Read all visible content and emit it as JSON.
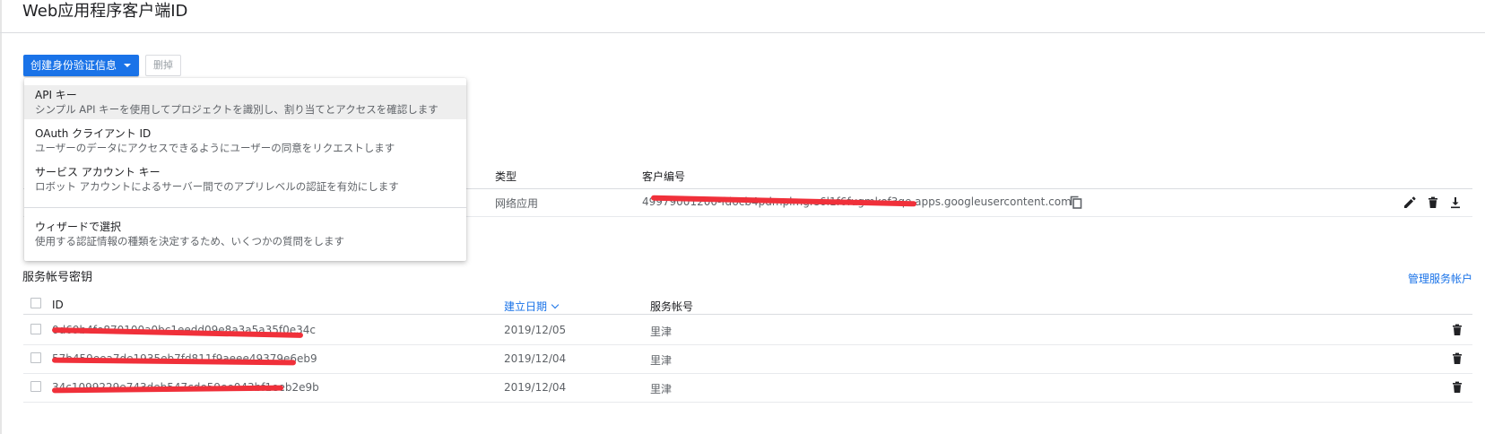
{
  "header": {
    "title": "Web应用程序客户端ID"
  },
  "toolbar": {
    "create_label": "创建身份验证信息",
    "delete_label": "删掉"
  },
  "create_menu": {
    "items": [
      {
        "title": "API キー",
        "desc": "シンプル API キーを使用してプロジェクトを識別し、割り当てとアクセスを確認します"
      },
      {
        "title": "OAuth クライアント ID",
        "desc": "ユーザーのデータにアクセスできるようにユーザーの同意をリクエストします"
      },
      {
        "title": "サービス アカウント キー",
        "desc": "ロボット アカウントによるサーバー間でのアプリレベルの認証を有効にします"
      },
      {
        "title": "ウィザードで選択",
        "desc": "使用する認証情報の種類を決定するため、いくつかの質問をします"
      }
    ]
  },
  "oauth_table": {
    "columns": {
      "type": "类型",
      "client_id": "客户编号"
    },
    "rows": [
      {
        "type": "网络应用",
        "client_id": "49979001200-fd6cb4pdmplmgrs6l1f6fugmkef3qe.apps.googleusercontent.com"
      }
    ]
  },
  "service_accounts": {
    "title": "服务帐号密钥",
    "manage_link": "管理服务帐户",
    "columns": {
      "id": "ID",
      "created": "建立日期",
      "account": "服务帐号"
    },
    "rows": [
      {
        "id": "0d69b4fe870100a0bc1eedd09e8a3a5a35f0e34c",
        "created": "2019/12/05",
        "account": "里津"
      },
      {
        "id": "57b459eea7de1935eb7fd811f9aeee49379e6eb9",
        "created": "2019/12/04",
        "account": "里津"
      },
      {
        "id": "34c1099229e743deb547cde59ee043bf1eeb2e9b",
        "created": "2019/12/04",
        "account": "里津"
      }
    ]
  },
  "icons": {
    "edit": "pencil-icon",
    "delete": "trash-icon",
    "download": "download-icon",
    "copy": "copy-icon"
  },
  "colors": {
    "accent": "#1a73e8",
    "redaction": "#f0303a"
  }
}
